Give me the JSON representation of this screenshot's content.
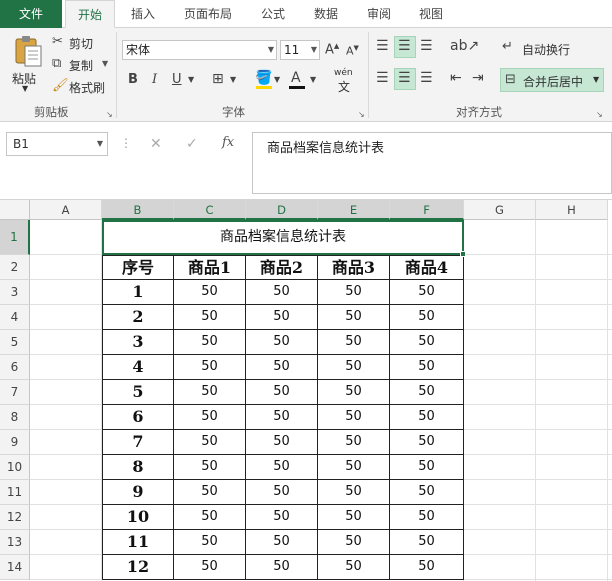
{
  "tabs": {
    "file": "文件",
    "items": [
      "开始",
      "插入",
      "页面布局",
      "公式",
      "数据",
      "审阅",
      "视图"
    ],
    "active_index": 0
  },
  "ribbon": {
    "clipboard": {
      "paste": "粘贴",
      "cut": "剪切",
      "copy": "复制",
      "format_painter": "格式刷",
      "label": "剪贴板"
    },
    "font": {
      "name": "宋体",
      "size": "11",
      "label": "字体",
      "bold": "B",
      "italic": "I",
      "underline": "U",
      "wen": "wén",
      "wen_char": "文"
    },
    "alignment": {
      "wrap_text": "自动换行",
      "merge_center": "合并后居中",
      "label": "对齐方式"
    }
  },
  "formula_bar": {
    "name_box": "B1",
    "content": "商品档案信息统计表"
  },
  "sheet": {
    "columns": [
      "A",
      "B",
      "C",
      "D",
      "E",
      "F",
      "G",
      "H"
    ],
    "selected_columns": [
      "B",
      "C",
      "D",
      "E",
      "F"
    ],
    "rows": [
      "1",
      "2",
      "3",
      "4",
      "5",
      "6",
      "7",
      "8",
      "9",
      "10",
      "11",
      "12",
      "13",
      "14"
    ],
    "title": "商品档案信息统计表",
    "headers": [
      "序号",
      "商品1",
      "商品2",
      "商品3",
      "商品4"
    ],
    "data": [
      [
        "1",
        "50",
        "50",
        "50",
        "50"
      ],
      [
        "2",
        "50",
        "50",
        "50",
        "50"
      ],
      [
        "3",
        "50",
        "50",
        "50",
        "50"
      ],
      [
        "4",
        "50",
        "50",
        "50",
        "50"
      ],
      [
        "5",
        "50",
        "50",
        "50",
        "50"
      ],
      [
        "6",
        "50",
        "50",
        "50",
        "50"
      ],
      [
        "7",
        "50",
        "50",
        "50",
        "50"
      ],
      [
        "8",
        "50",
        "50",
        "50",
        "50"
      ],
      [
        "9",
        "50",
        "50",
        "50",
        "50"
      ],
      [
        "10",
        "50",
        "50",
        "50",
        "50"
      ],
      [
        "11",
        "50",
        "50",
        "50",
        "50"
      ],
      [
        "12",
        "50",
        "50",
        "50",
        "50"
      ]
    ]
  },
  "colors": {
    "accent": "#217346",
    "selection": "#c6e7d4"
  }
}
